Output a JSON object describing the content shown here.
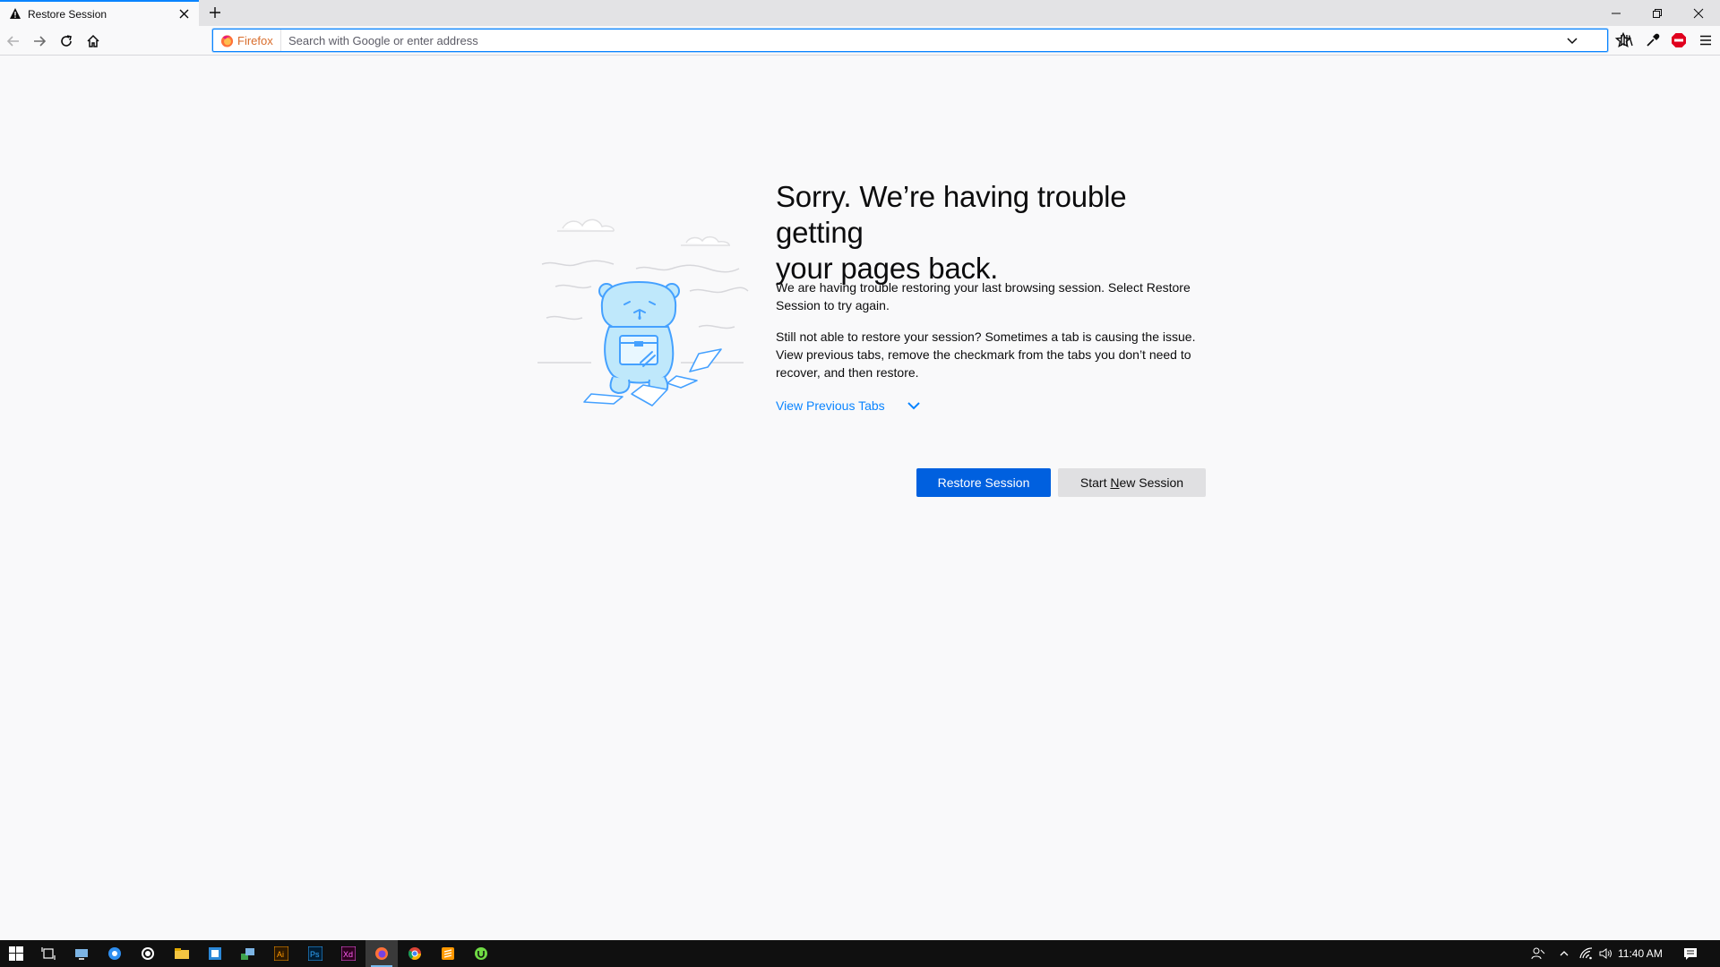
{
  "browser": {
    "tab": {
      "title": "Restore Session",
      "icon": "warning-icon"
    },
    "window_controls": [
      "minimize-icon",
      "restore-icon",
      "close-icon"
    ],
    "urlbar": {
      "identity_label": "Firefox",
      "placeholder": "Search with Google or enter address",
      "value": ""
    },
    "toolbar_icons": [
      "library-icon",
      "eyedropper-icon",
      "adblock-plus-icon",
      "hamburger-menu-icon"
    ]
  },
  "page": {
    "title_line1": "Sorry. We’re having trouble getting",
    "title_line2": "your pages back.",
    "paragraph1": "We are having trouble restoring your last browsing session. Select Restore Session to try again.",
    "paragraph2": "Still not able to restore your session? Sometimes a tab is causing the issue. View previous tabs, remove the checkmark from the tabs you don’t need to recover, and then restore.",
    "view_previous_tabs": "View Previous Tabs",
    "restore_button": "Restore Session",
    "new_session_button_pre": "Start ",
    "new_session_button_accel": "N",
    "new_session_button_post": "ew Session"
  },
  "colors": {
    "accent": "#0a84ff",
    "primary_button": "#0060df",
    "secondary_button": "#e0e0e2",
    "page_background": "#f9f9fa",
    "taskbar": "#101010"
  },
  "taskbar": {
    "icons": [
      "windows-start-icon",
      "task-view-icon",
      "network-app-icon",
      "skype-icon",
      "whatsapp-icon",
      "file-explorer-icon",
      "notes-app-icon",
      "app-icon",
      "illustrator-icon",
      "photoshop-icon",
      "adobe-xd-icon",
      "firefox-icon",
      "chrome-icon",
      "sublime-icon",
      "upwork-icon"
    ],
    "active_app": "firefox-icon",
    "clock": "11:40 AM"
  }
}
